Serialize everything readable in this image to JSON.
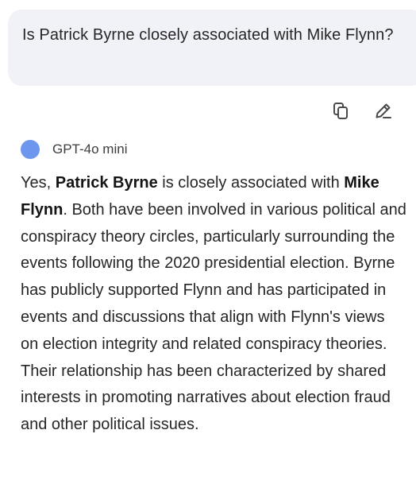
{
  "user_message": {
    "text": "Is Patrick Byrne closely associated with Mike Flynn?"
  },
  "message_actions": {
    "copy_icon": "copy-icon",
    "edit_icon": "edit-pencil-icon"
  },
  "assistant": {
    "model_name": "GPT-4o mini",
    "avatar_color": "#6f96ef",
    "response": {
      "part1": "Yes, ",
      "bold1": "Patrick Byrne",
      "part2": " is closely associated with ",
      "bold2": "Mike Flynn",
      "part3": ". Both have been involved in various political and conspiracy theory circles, particularly surrounding the events following the 2020 presidential election. Byrne has publicly supported Flynn and has participated in events and discussions that align with Flynn's views on election integrity and related conspiracy theories. Their relationship has been characterized by shared interests in promoting narratives about election fraud and other political issues."
    }
  }
}
